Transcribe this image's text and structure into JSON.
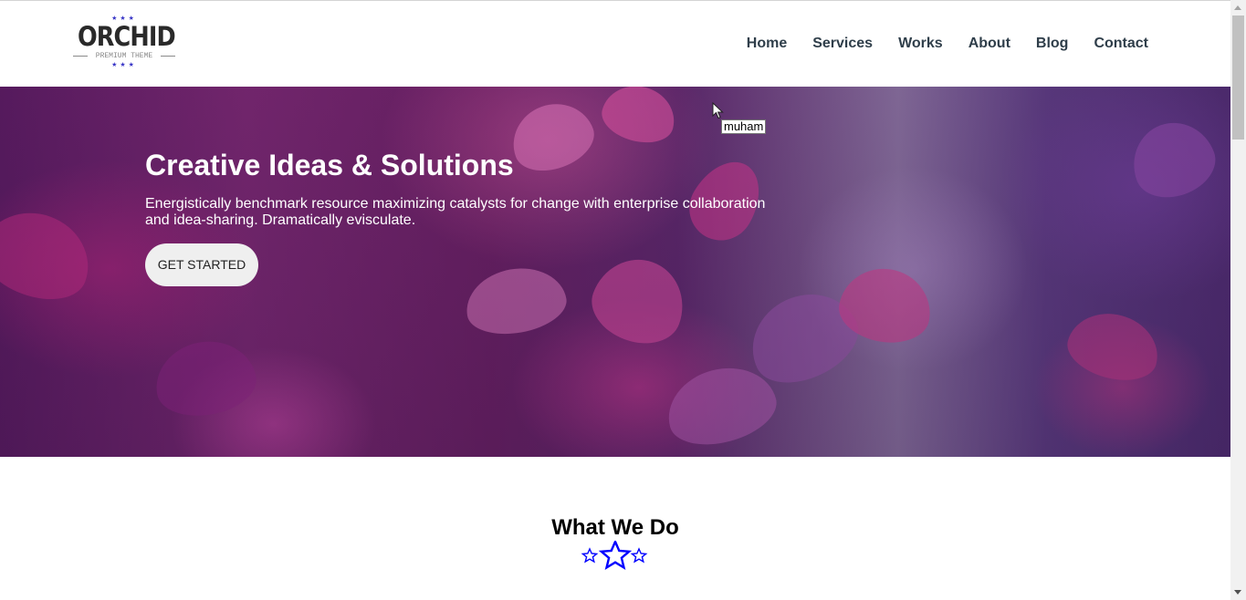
{
  "logo": {
    "name": "ORCHID",
    "tagline": "PREMIUM THEME"
  },
  "nav": {
    "items": [
      "Home",
      "Services",
      "Works",
      "About",
      "Blog",
      "Contact"
    ]
  },
  "hero": {
    "title": "Creative Ideas & Solutions",
    "text": "Energistically benchmark resource maximizing catalysts for change with enterprise collaboration and idea-sharing. Dramatically evisculate.",
    "button_label": "GET STARTED"
  },
  "tooltip": {
    "text": "muham"
  },
  "section": {
    "title": "What We Do",
    "divider_icon": "stars-icon",
    "star_color": "#0000ff"
  },
  "colors": {
    "nav_text": "#2f3e4a",
    "logo_stars": "#3a37c7",
    "button_bg": "#efefef"
  }
}
